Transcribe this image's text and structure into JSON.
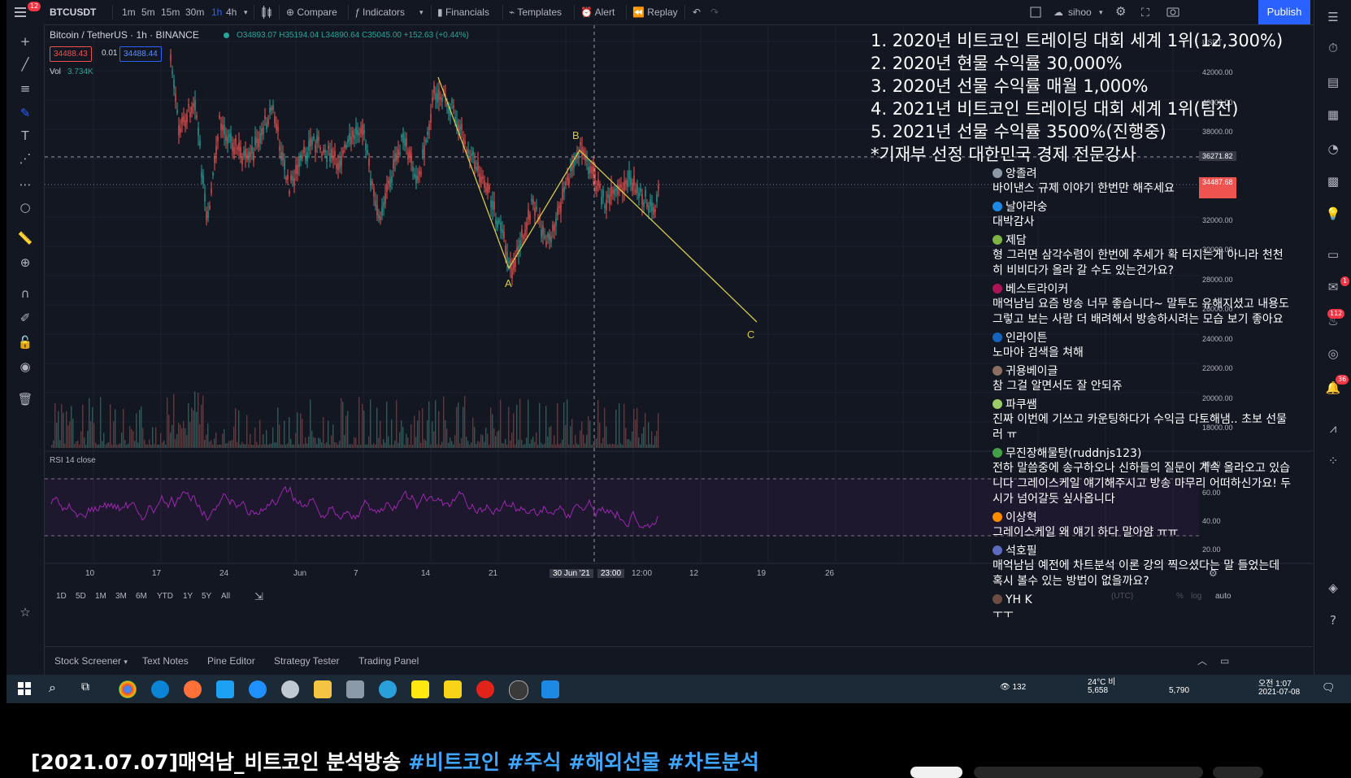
{
  "toolbar": {
    "symbol": "BTCUSDT",
    "intervals": [
      "1m",
      "5m",
      "15m",
      "30m",
      "1h",
      "4h"
    ],
    "active_interval": "1h",
    "compare": "Compare",
    "indicators": "Indicators",
    "financials": "Financials",
    "templates": "Templates",
    "alert": "Alert",
    "replay": "Replay",
    "user": "sihoo",
    "publish": "Publish",
    "notif_count": "12"
  },
  "legend": {
    "title": "Bitcoin / TetherUS · 1h · BINANCE",
    "ohlc": "O34893.07 H35194.04 L34890.64 C35045.00 +152.63 (+0.44%)",
    "sell_price": "34488.43",
    "spread": "0.01",
    "buy_price": "34488.44",
    "vol_label": "Vol",
    "vol_value": "3.734K",
    "rsi_label": "RSI 14 close"
  },
  "colors": {
    "bg": "#131722",
    "up": "#26a69a",
    "down": "#ef5350",
    "wave": "#d4c94a",
    "rsi": "#9c27b0",
    "accent": "#2962ff"
  },
  "price_axis": [
    "USDT",
    "42000.00",
    "40000.00",
    "38000.00",
    "36271.82",
    "34487.68",
    "32000.00",
    "30000.00",
    "28000.00",
    "26000.00",
    "24000.00",
    "22000.00",
    "20000.00",
    "18000.00"
  ],
  "rsi_axis": [
    "80.00",
    "60.00",
    "40.00",
    "20.00"
  ],
  "time_axis": [
    "10",
    "17",
    "24",
    "Jun",
    "7",
    "14",
    "21",
    "30 Jun '21",
    "23:00",
    "12:00",
    "12",
    "19",
    "26"
  ],
  "wave_labels": {
    "a": "A",
    "b": "B",
    "c": "C"
  },
  "ranges": [
    "1D",
    "5D",
    "1M",
    "3M",
    "6M",
    "YTD",
    "1Y",
    "5Y",
    "All"
  ],
  "scale_opts": {
    "pct": "%",
    "log": "log",
    "auto": "auto",
    "tz": "(UTC)"
  },
  "bottom_tabs": [
    "Stock Screener",
    "Text Notes",
    "Pine Editor",
    "Strategy Tester",
    "Trading Panel"
  ],
  "achievements": [
    "1. 2020년 비트코인 트레이딩 대회 세계 1위(12,300%)",
    "2. 2020년 현물 수익률 30,000%",
    "3. 2020년 선물 수익률 매월 1,000%",
    "4. 2021년 비트코인 트레이딩 대회 세계 1위(팀전)",
    "5. 2021년 선물 수익률 3500%(진행중)",
    "*기재부 선정 대한민국 경제 전문강사"
  ],
  "chat": [
    {
      "user": "앙졸려",
      "text": "바이낸스 규제 이야기 한번만 해주세요",
      "color": "#8e99a8"
    },
    {
      "user": "날아라숭",
      "text": "대박감사",
      "color": "#1e88e5"
    },
    {
      "user": "제담",
      "text": "형 그러면 삼각수렴이 한번에 추세가 확 터지는게 아니라 천천히 비비다가 올라 갈 수도 있는건가요?",
      "color": "#7cb342"
    },
    {
      "user": "베스트라이커",
      "text": "매억남님 요즘 방송 너무 좋습니다~ 말투도 유해지셨고 내용도 그렇고 보는 사람 더 배려해서 방송하시려는 모습 보기 좋아요",
      "color": "#ad1457"
    },
    {
      "user": "인라이튼",
      "text": "노마야 검색을 쳐해",
      "color": "#1565c0"
    },
    {
      "user": "귀용베이글",
      "text": "참 그걸 알면서도 잘 안되쥬",
      "color": "#8d6e63"
    },
    {
      "user": "파쿠쌤",
      "text": "진짜 이번에 기쓰고 카운팅하다가 수익금 다토해냄.. 초보 선물러 ㅠ",
      "color": "#9ccc65"
    },
    {
      "user": "무진장해물탕(ruddnjs123)",
      "text": "전하 말씀중에 송구하오나 신하들의 질문이 계속 올라오고 있습니다 그레이스케일 얘기해주시고 방송 마무리 어떠하신가요! 두시가 넘어갈듯 싶사옵니다",
      "color": "#43a047"
    },
    {
      "user": "이상혁",
      "text": "그레이스케일 왜 얘기 하다 말아얌 ㅠㅠ",
      "color": "#fb8c00"
    },
    {
      "user": "석호필",
      "text": "매억남님 예전에 차트분석 이론 강의 찍으셨다는 말 들었는데 혹시 볼수 있는 방법이 없을까요?",
      "color": "#5c6bc0"
    },
    {
      "user": "YH K",
      "text": "ㅜㅜ",
      "color": "#6d4c41"
    }
  ],
  "viewers": "132",
  "tray": {
    "weather": "24°C 비",
    "likes": "5,658",
    "subs": "5,790",
    "time": "오전 1:07",
    "date": "2021-07-08"
  },
  "right_badges": {
    "notif": "1",
    "chat": "112",
    "alerts": "36"
  },
  "video_title": {
    "main": "[2021.07.07]매억남_비트코인 분석방송",
    "tags": "#비트코인 #주식 #해외선물 #차트분석"
  }
}
